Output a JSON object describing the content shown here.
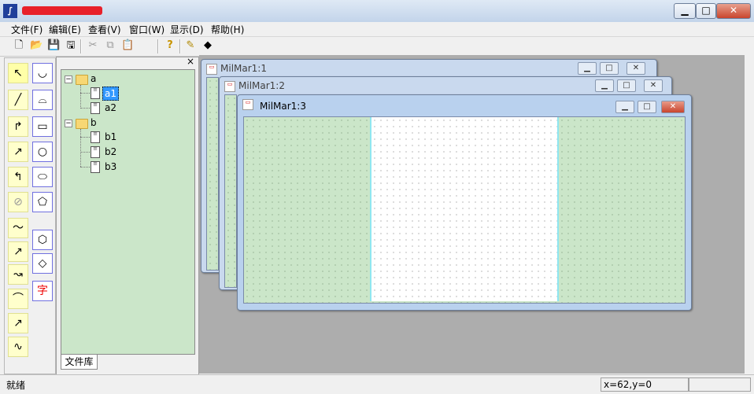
{
  "titlebar": {
    "app_icon": "app-logo-icon",
    "buttons": {
      "minimize": "▁",
      "maximize": "□",
      "close": "✕"
    }
  },
  "menu": [
    "文件(F)",
    "编辑(E)",
    "查看(V)",
    "窗口(W)",
    "显示(D)",
    "帮助(H)"
  ],
  "toolbar": {
    "icons": [
      "new-file-icon",
      "open-folder-icon",
      "save-icon",
      "save-all-icon",
      "cut-icon",
      "copy-icon",
      "paste-icon",
      "help-icon",
      "pencil-icon",
      "diamond-icon"
    ]
  },
  "palette": {
    "text_tool": "字"
  },
  "tree": {
    "folders": [
      {
        "name": "a",
        "items": [
          "a1",
          "a2"
        ]
      },
      {
        "name": "b",
        "items": [
          "b1",
          "b2",
          "b3"
        ]
      }
    ],
    "selected": "a1",
    "tab": "文件库"
  },
  "windows": [
    {
      "title": "MilMar1:1"
    },
    {
      "title": "MilMar1:2"
    },
    {
      "title": "MilMar1:3"
    }
  ],
  "status": {
    "text": "就绪",
    "coords": "x=62,y=0"
  },
  "colors": {
    "canvas_bg": "#cbe6c9",
    "page_bg": "#ffffff",
    "title_redaction": "#e8202a",
    "selection": "#3399ff"
  }
}
